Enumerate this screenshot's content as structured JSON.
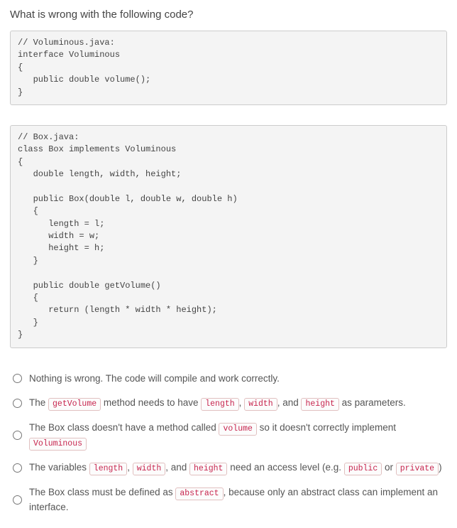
{
  "question": "What is wrong with the following code?",
  "code1": "// Voluminous.java:\ninterface Voluminous\n{\n   public double volume();\n}",
  "code2": "// Box.java:\nclass Box implements Voluminous\n{\n   double length, width, height;\n\n   public Box(double l, double w, double h)\n   {\n      length = l;\n      width = w;\n      height = h;\n   }\n\n   public double getVolume()\n   {\n      return (length * width * height);\n   }\n}",
  "choices": {
    "a": {
      "plain": "Nothing is wrong. The code will compile and work correctly."
    },
    "b": {
      "p1": "The ",
      "t1": "getVolume",
      "p2": " method needs to have ",
      "t2": "length",
      "p3": ", ",
      "t3": "width",
      "p4": ", and ",
      "t4": "height",
      "p5": " as parameters."
    },
    "c": {
      "p1": "The Box class doesn't have a method called ",
      "t1": "volume",
      "p2": " so it doesn't correctly implement ",
      "t2": "Voluminous"
    },
    "d": {
      "p1": "The variables ",
      "t1": "length",
      "p2": ", ",
      "t2": "width",
      "p3": ", and ",
      "t3": "height",
      "p4": " need an access level (e.g. ",
      "t4": "public",
      "p5": " or ",
      "t5": "private",
      "p6": ")"
    },
    "e": {
      "p1": "The Box class must be defined as ",
      "t1": "abstract",
      "p2": ", because only an abstract class can implement an interface."
    }
  }
}
